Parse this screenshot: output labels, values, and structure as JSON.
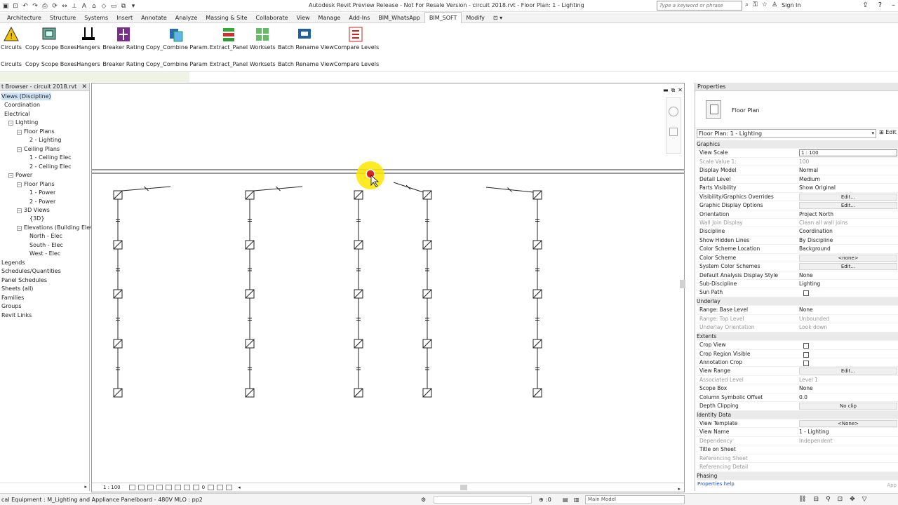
{
  "window": {
    "title": "Autodesk Revit Preview Release - Not For Resale Version -   circuit 2018.rvt - Floor Plan: 1 - Lighting",
    "search_placeholder": "Type a keyword or phrase",
    "sign_in": "Sign In"
  },
  "tabs": [
    "Architecture",
    "Structure",
    "Systems",
    "Insert",
    "Annotate",
    "Analyze",
    "Massing & Site",
    "Collaborate",
    "View",
    "Manage",
    "Add-Ins",
    "BIM_WhatsApp",
    "BIM_SOFT",
    "Modify"
  ],
  "active_tab": "BIM_SOFT",
  "ribbon": {
    "buttons": [
      {
        "label": "Circuits",
        "panel_label": "Circuits",
        "icon": "warning-icon"
      },
      {
        "label": "Copy Scope Boxes",
        "panel_label": "Copy Scope Boxes",
        "icon": "scope-box-icon"
      },
      {
        "label": "Hangers",
        "panel_label": "Hangers",
        "icon": "hanger-icon"
      },
      {
        "label": "Breaker Rating",
        "panel_label": "Breaker Rating",
        "icon": "breaker-icon"
      },
      {
        "label": "Copy_Combine Param.",
        "panel_label": "Copy_Combine Param",
        "icon": "copy-param-icon"
      },
      {
        "label": "Extract_Panel",
        "panel_label": "Extract_Panel",
        "icon": "extract-panel-icon"
      },
      {
        "label": "Worksets",
        "panel_label": "Worksets",
        "icon": "worksets-icon"
      },
      {
        "label": "Batch Rename View",
        "panel_label": "Batch Rename View",
        "icon": "rename-icon"
      },
      {
        "label": "Compare Levels",
        "panel_label": "Compare Levels",
        "icon": "compare-icon"
      }
    ]
  },
  "project_browser": {
    "title": "t Browser - circuit 2018.rvt",
    "items": [
      {
        "label": "Views (Discipline)",
        "toggle": "",
        "selected": true
      },
      {
        "label": "Coordination",
        "toggle": ""
      },
      {
        "label": "Electrical",
        "toggle": ""
      },
      {
        "label": "Lighting",
        "toggle": "−"
      },
      {
        "label": "Floor Plans",
        "toggle": "−"
      },
      {
        "label": "2 - Lighting",
        "toggle": ""
      },
      {
        "label": "Ceiling Plans",
        "toggle": "−"
      },
      {
        "label": "1 - Ceiling Elec",
        "toggle": ""
      },
      {
        "label": "2 - Ceiling Elec",
        "toggle": ""
      },
      {
        "label": "Power",
        "toggle": "−"
      },
      {
        "label": "Floor Plans",
        "toggle": "−"
      },
      {
        "label": "1 - Power",
        "toggle": ""
      },
      {
        "label": "2 - Power",
        "toggle": ""
      },
      {
        "label": "3D Views",
        "toggle": "−"
      },
      {
        "label": "{3D}",
        "toggle": ""
      },
      {
        "label": "Elevations (Building Elev",
        "toggle": "−"
      },
      {
        "label": "North - Elec",
        "toggle": ""
      },
      {
        "label": "South - Elec",
        "toggle": ""
      },
      {
        "label": "West - Elec",
        "toggle": ""
      },
      {
        "label": "Legends",
        "toggle": ""
      },
      {
        "label": "Schedules/Quantities",
        "toggle": ""
      },
      {
        "label": "Panel Schedules",
        "toggle": ""
      },
      {
        "label": "Sheets (all)",
        "toggle": ""
      },
      {
        "label": "Families",
        "toggle": ""
      },
      {
        "label": "Groups",
        "toggle": ""
      },
      {
        "label": "Revit Links",
        "toggle": ""
      }
    ]
  },
  "view": {
    "scale": "1 : 100",
    "detail_number": "0"
  },
  "properties": {
    "title": "Properties",
    "type_name": "Floor Plan",
    "instance": "Floor Plan: 1 - Lighting",
    "edit_type": "Edit",
    "rows": [
      {
        "group": "Graphics"
      },
      {
        "k": "View Scale",
        "v": "1 : 100",
        "kind": "input"
      },
      {
        "k": "Scale Value    1:",
        "v": "100",
        "dis": true
      },
      {
        "k": "Display Model",
        "v": "Normal"
      },
      {
        "k": "Detail Level",
        "v": "Medium"
      },
      {
        "k": "Parts Visibility",
        "v": "Show Original"
      },
      {
        "k": "Visibility/Graphics Overrides",
        "v": "Edit...",
        "kind": "button"
      },
      {
        "k": "Graphic Display Options",
        "v": "Edit...",
        "kind": "button"
      },
      {
        "k": "Orientation",
        "v": "Project North"
      },
      {
        "k": "Wall Join Display",
        "v": "Clean all wall joins",
        "dis": true
      },
      {
        "k": "Discipline",
        "v": "Coordination"
      },
      {
        "k": "Show Hidden Lines",
        "v": "By Discipline"
      },
      {
        "k": "Color Scheme Location",
        "v": "Background"
      },
      {
        "k": "Color Scheme",
        "v": "<none>",
        "kind": "button"
      },
      {
        "k": "System Color Schemes",
        "v": "Edit...",
        "kind": "button"
      },
      {
        "k": "Default Analysis Display Style",
        "v": "None"
      },
      {
        "k": "Sub-Discipline",
        "v": "Lighting"
      },
      {
        "k": "Sun Path",
        "v": "",
        "kind": "check"
      },
      {
        "group": "Underlay"
      },
      {
        "k": "Range: Base Level",
        "v": "None"
      },
      {
        "k": "Range: Top Level",
        "v": "Unbounded",
        "dis": true
      },
      {
        "k": "Underlay Orientation",
        "v": "Look down",
        "dis": true
      },
      {
        "group": "Extents"
      },
      {
        "k": "Crop View",
        "v": "",
        "kind": "check"
      },
      {
        "k": "Crop Region Visible",
        "v": "",
        "kind": "check"
      },
      {
        "k": "Annotation Crop",
        "v": "",
        "kind": "check"
      },
      {
        "k": "View Range",
        "v": "Edit...",
        "kind": "button"
      },
      {
        "k": "Associated Level",
        "v": "Level 1",
        "dis": true
      },
      {
        "k": "Scope Box",
        "v": "None"
      },
      {
        "k": "Column Symbolic Offset",
        "v": "0.0"
      },
      {
        "k": "Depth Clipping",
        "v": "No clip",
        "kind": "button"
      },
      {
        "group": "Identity Data"
      },
      {
        "k": "View Template",
        "v": "<None>",
        "kind": "button"
      },
      {
        "k": "View Name",
        "v": "1 - Lighting"
      },
      {
        "k": "Dependency",
        "v": "Independent",
        "dis": true
      },
      {
        "k": "Title on Sheet",
        "v": ""
      },
      {
        "k": "Referencing Sheet",
        "v": "",
        "dis": true
      },
      {
        "k": "Referencing Detail",
        "v": "",
        "dis": true
      },
      {
        "group": "Phasing"
      }
    ],
    "help": "Properties help",
    "apply": "App"
  },
  "status": {
    "text": "cal Equipment : M_Lighting and Appliance Panelboard - 480V MLO : pp2",
    "zero": ":0",
    "model": "Main Model"
  }
}
